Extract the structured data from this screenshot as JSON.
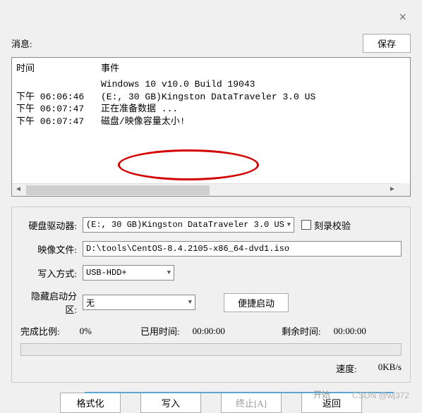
{
  "window": {
    "close": "×"
  },
  "topbar": {
    "message_label": "消息:",
    "save_label": "保存"
  },
  "log": {
    "header_time": "时间",
    "header_event": "事件",
    "rows": [
      {
        "time": "",
        "event": "Windows 10 v10.0 Build 19043"
      },
      {
        "time": "下午 06:06:46",
        "event": "(E:, 30 GB)Kingston DataTraveler 3.0 US"
      },
      {
        "time": "下午 06:07:47",
        "event": "正在准备数据 ..."
      },
      {
        "time": "下午 06:07:47",
        "event": "磁盘/映像容量太小!"
      }
    ]
  },
  "form": {
    "drive_label": "硬盘驱动器:",
    "drive_value": "(E:, 30 GB)Kingston DataTraveler 3.0 US",
    "verify_label": "刻录校验",
    "image_label": "映像文件:",
    "image_value": "D:\\tools\\CentOS-8.4.2105-x86_64-dvd1.iso",
    "write_mode_label": "写入方式:",
    "write_mode_value": "USB-HDD+",
    "hidden_boot_label": "隐藏启动分区:",
    "hidden_boot_value": "无",
    "quick_boot_label": "便捷启动"
  },
  "stats": {
    "complete_label": "完成比例:",
    "complete_value": "0%",
    "elapsed_label": "已用时间:",
    "elapsed_value": "00:00:00",
    "remaining_label": "剩余时间:",
    "remaining_value": "00:00:00",
    "speed_label": "速度:",
    "speed_value": "0KB/s"
  },
  "buttons": {
    "format": "格式化",
    "write": "写入",
    "abort": "终止[A]",
    "back": "返回"
  },
  "footer": {
    "start_hint": "开始",
    "watermark": "CSDN @wj372"
  }
}
